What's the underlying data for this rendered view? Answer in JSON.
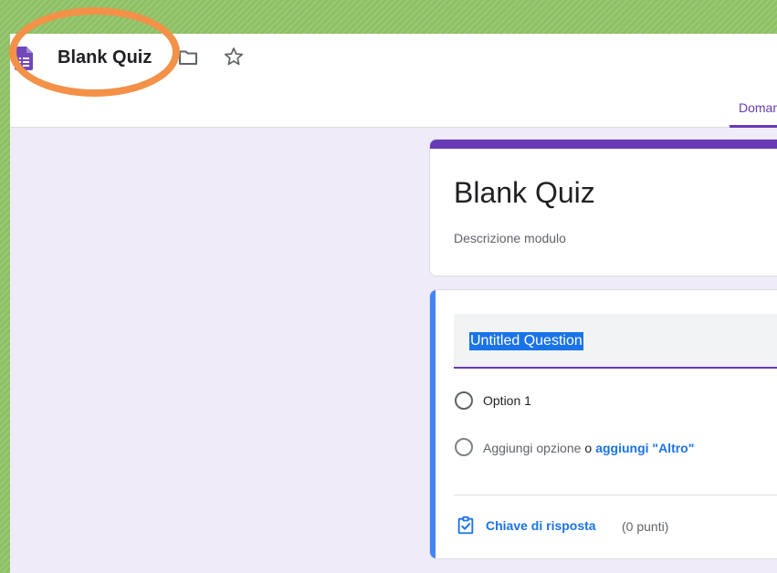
{
  "header": {
    "app_icon": "google-forms-icon",
    "doc_title": "Blank Quiz",
    "folder_icon": "folder-icon",
    "star_icon": "star-icon",
    "tabs": [
      {
        "label": "Domande"
      }
    ]
  },
  "form": {
    "title": "Blank Quiz",
    "description_placeholder": "Descrizione modulo",
    "accent_color": "#673ab7",
    "background_color": "#f0ebf8"
  },
  "question": {
    "title": "Untitled Question",
    "options": [
      {
        "label": "Option 1"
      }
    ],
    "add_option_label": "Aggiungi opzione",
    "or_label": "o",
    "add_other_label": "aggiungi \"Altro\"",
    "answer_key_label": "Chiave di risposta",
    "points_label": "(0 punti)",
    "focus_color": "#4285f4"
  },
  "annotation": {
    "highlight_color": "#f39148"
  }
}
